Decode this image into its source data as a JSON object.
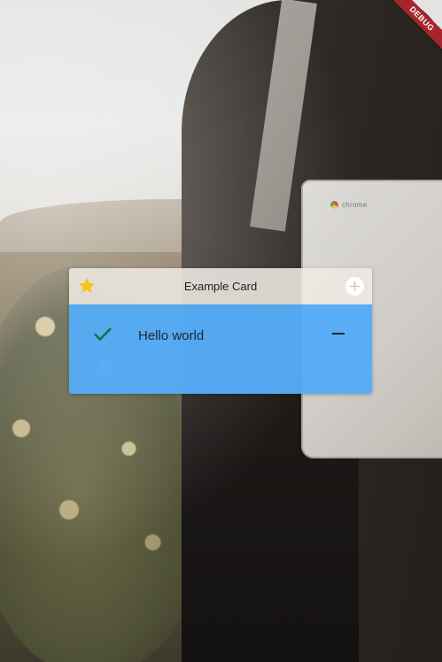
{
  "debug_banner": {
    "label": "DEBUG"
  },
  "background": {
    "laptop_brand": "chrome"
  },
  "card": {
    "title": "Example Card",
    "leading_icon": "star-icon",
    "trailing_icon": "add-circle-icon",
    "item": {
      "text": "Hello world",
      "status_icon": "check-icon",
      "action_icon": "remove-icon"
    }
  },
  "colors": {
    "card_body": "#54abf5",
    "star": "#f5c518",
    "check": "#1e6b3a",
    "debug_ribbon": "#a8232a"
  }
}
